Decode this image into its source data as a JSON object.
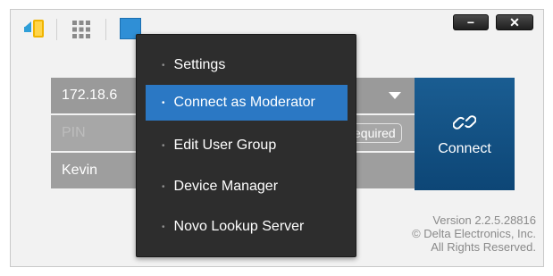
{
  "titlebar": {
    "icons": [
      "app-logo-icon",
      "grid-icon",
      "menu-icon"
    ],
    "minimize_label": "−",
    "close_label": "✕"
  },
  "form": {
    "ip_value": "172.18.6",
    "pin_label": "PIN",
    "pin_badge": "equired",
    "name_value": "Kevin"
  },
  "connect": {
    "icon": "link-icon",
    "label": "Connect"
  },
  "footer": {
    "version": "Version 2.2.5.28816",
    "copyright": "© Delta Electronics, Inc.",
    "rights": "All Rights Reserved."
  },
  "menu": {
    "items": [
      {
        "label": "Settings",
        "active": false
      },
      {
        "label": "Connect as Moderator",
        "active": true
      },
      {
        "label": "Edit User Group",
        "active": false
      },
      {
        "label": "Device Manager",
        "active": false
      },
      {
        "label": "Novo Lookup Server",
        "active": false
      }
    ],
    "bullet": "•"
  },
  "colors": {
    "accent": "#2b78c4",
    "menu_bg": "#2d2d2d",
    "connect_bg": "#0d4676"
  }
}
